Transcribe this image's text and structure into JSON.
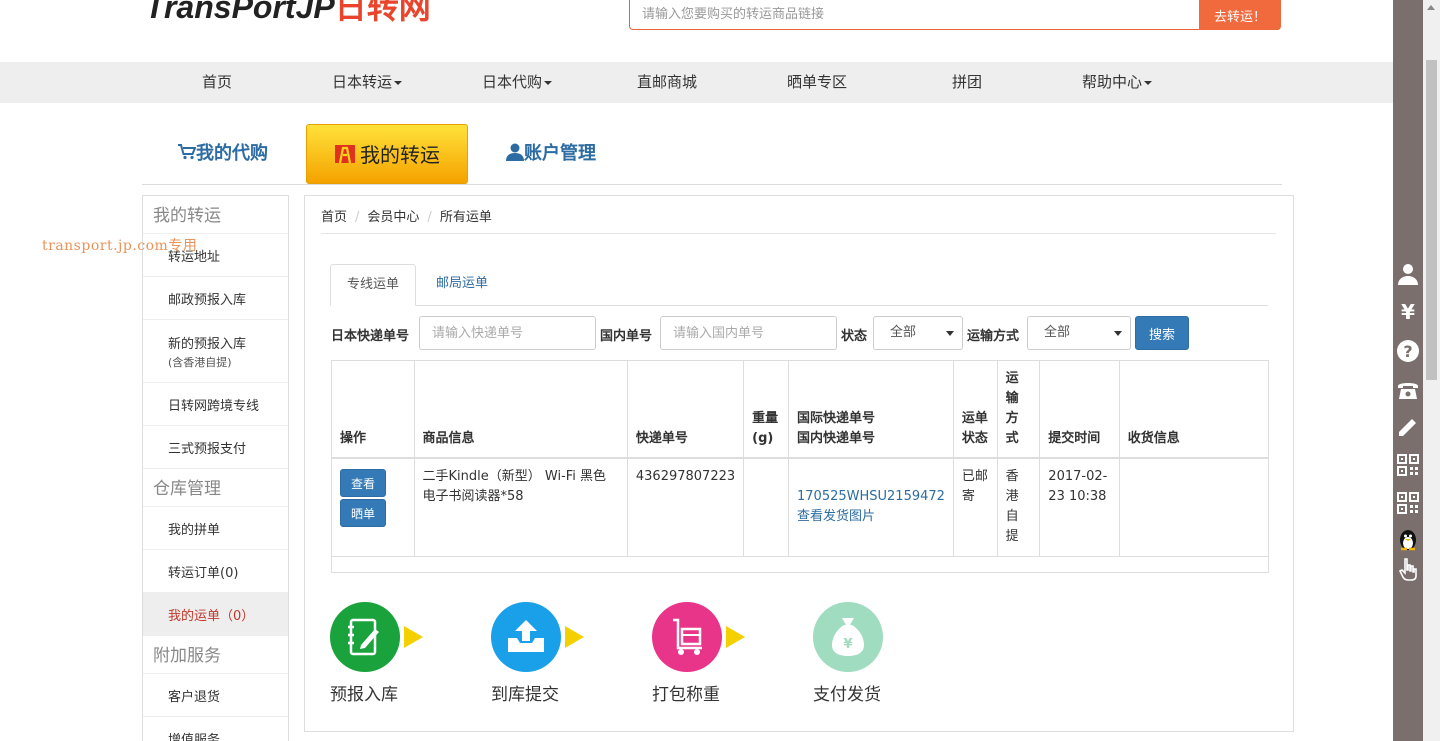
{
  "header": {
    "logo_text": "TransPortJP",
    "logo_cn": "日转网",
    "search_placeholder": "请输入您要购买的转运商品链接",
    "search_button": "去转运！"
  },
  "nav": [
    {
      "label": "首页",
      "dropdown": false
    },
    {
      "label": "日本转运",
      "dropdown": true
    },
    {
      "label": "日本代购",
      "dropdown": true
    },
    {
      "label": "直邮商城",
      "dropdown": false
    },
    {
      "label": "晒单专区",
      "dropdown": false
    },
    {
      "label": "拼团",
      "dropdown": false
    },
    {
      "label": "帮助中心",
      "dropdown": true
    }
  ],
  "main_tabs": {
    "purchase": "我的代购",
    "transport": "我的转运",
    "account": "账户管理"
  },
  "watermark": "transport.jp.com专用",
  "sidebar": {
    "sections": [
      {
        "title": "我的转运",
        "items": [
          {
            "label": "转运地址"
          },
          {
            "label": "邮政预报入库"
          },
          {
            "label": "新的预报入库",
            "sub": "(含香港自提)"
          },
          {
            "label": "日转网跨境专线"
          },
          {
            "label": "三式预报支付"
          }
        ]
      },
      {
        "title": "仓库管理",
        "items": [
          {
            "label": "我的拼单"
          },
          {
            "label": "转运订单(0)"
          },
          {
            "label": "我的运单（0）"
          }
        ]
      },
      {
        "title": "附加服务",
        "items": [
          {
            "label": "客户退货"
          },
          {
            "label": "增值服务"
          }
        ]
      }
    ]
  },
  "breadcrumb": [
    "首页",
    "会员中心",
    "所有运单"
  ],
  "sub_tabs": [
    "专线运单",
    "邮局运单"
  ],
  "filters": {
    "jp_tracking_label": "日本快递单号",
    "jp_tracking_placeholder": "请输入快递单号",
    "domestic_label": "国内单号",
    "domestic_placeholder": "请输入国内单号",
    "status_label": "状态",
    "status_value": "全部",
    "method_label": "运输方式",
    "method_value": "全部",
    "search_button": "搜索"
  },
  "table": {
    "headers": {
      "op": "操作",
      "goods": "商品信息",
      "tracking": "快递单号",
      "weight": "重量(g)",
      "intl_1": "国际快递单号",
      "intl_2": "国内快递单号",
      "status": "运单状态",
      "method": "运输方式",
      "time": "提交时间",
      "receiver": "收货信息"
    },
    "rows": [
      {
        "btn_view": "查看",
        "btn_share": "晒单",
        "goods": "二手Kindle（新型） Wi-Fi 黑色电子书阅读器*58",
        "tracking": "436297807223",
        "weight": "",
        "intl_tracking": "170525WHSU2159472",
        "photo_link": "查看发货图片",
        "status": "已邮寄",
        "method": "香港自提",
        "time": "2017-02-23 10:38",
        "receiver": ""
      }
    ]
  },
  "steps": [
    {
      "label": "预报入库",
      "color": "#1aa33c"
    },
    {
      "label": "到库提交",
      "color": "#1aa0e8"
    },
    {
      "label": "打包称重",
      "color": "#e8358a"
    },
    {
      "label": "支付发货",
      "color": "#9fdcc0"
    }
  ],
  "colors": {
    "accent_orange": "#f06a3d",
    "link_blue": "#2d6ca2",
    "button_blue": "#337ab7",
    "active_tab_yellow": "#ffd21a"
  }
}
